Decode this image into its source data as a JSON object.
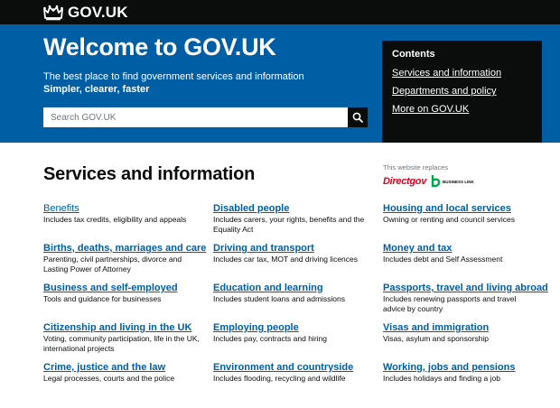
{
  "header": {
    "logo_text": "GOV.UK",
    "crown_icon": "crown-icon"
  },
  "hero": {
    "title": "Welcome to GOV.UK",
    "subtitle": "The best place to find government services and information",
    "strapline": "Simpler, clearer, faster",
    "search_placeholder": "Search GOV.UK",
    "search_icon": "magnifying-glass-icon"
  },
  "contents": {
    "title": "Contents",
    "links": [
      "Services and information",
      "Departments and policy",
      "More on GOV.UK"
    ]
  },
  "section": {
    "title": "Services and information",
    "replaces_text": "This website replaces",
    "directgov": "Directgov",
    "business_link": "BUSINESS LINK"
  },
  "services": [
    {
      "title": "Benefits",
      "desc": "Includes tax credits, eligibility and appeals"
    },
    {
      "title": "Disabled people",
      "desc": "Includes carers, your rights, benefits and the Equality Act"
    },
    {
      "title": "Housing and local services",
      "desc": "Owning or renting and council services"
    },
    {
      "title": "Births, deaths, marriages and care",
      "desc": "Parenting, civil partnerships, divorce and Lasting Power of Attorney"
    },
    {
      "title": "Driving and transport",
      "desc": "Includes car tax, MOT and driving licences"
    },
    {
      "title": "Money and tax",
      "desc": "Includes debt and Self Assessment"
    },
    {
      "title": "Business and self-employed",
      "desc": "Tools and guidance for businesses"
    },
    {
      "title": "Education and learning",
      "desc": "Includes student loans and admissions"
    },
    {
      "title": "Passports, travel and living abroad",
      "desc": "Includes renewing passports and travel advice by country"
    },
    {
      "title": "Citizenship and living in the UK",
      "desc": "Voting, community participation, life in the UK, international projects"
    },
    {
      "title": "Employing people",
      "desc": "Includes pay, contracts and hiring"
    },
    {
      "title": "Visas and immigration",
      "desc": "Visas, asylum and sponsorship"
    },
    {
      "title": "Crime, justice and the law",
      "desc": "Legal processes, courts and the police"
    },
    {
      "title": "Environment and countryside",
      "desc": "Includes flooding, recycling and wildlife"
    },
    {
      "title": "Working, jobs and pensions",
      "desc": "Includes holidays and finding a job"
    }
  ],
  "colors": {
    "header_bg": "#0b0c0c",
    "hero_bg": "#005ea5",
    "link": "#005ea5",
    "directgov_red": "#e3001b"
  }
}
